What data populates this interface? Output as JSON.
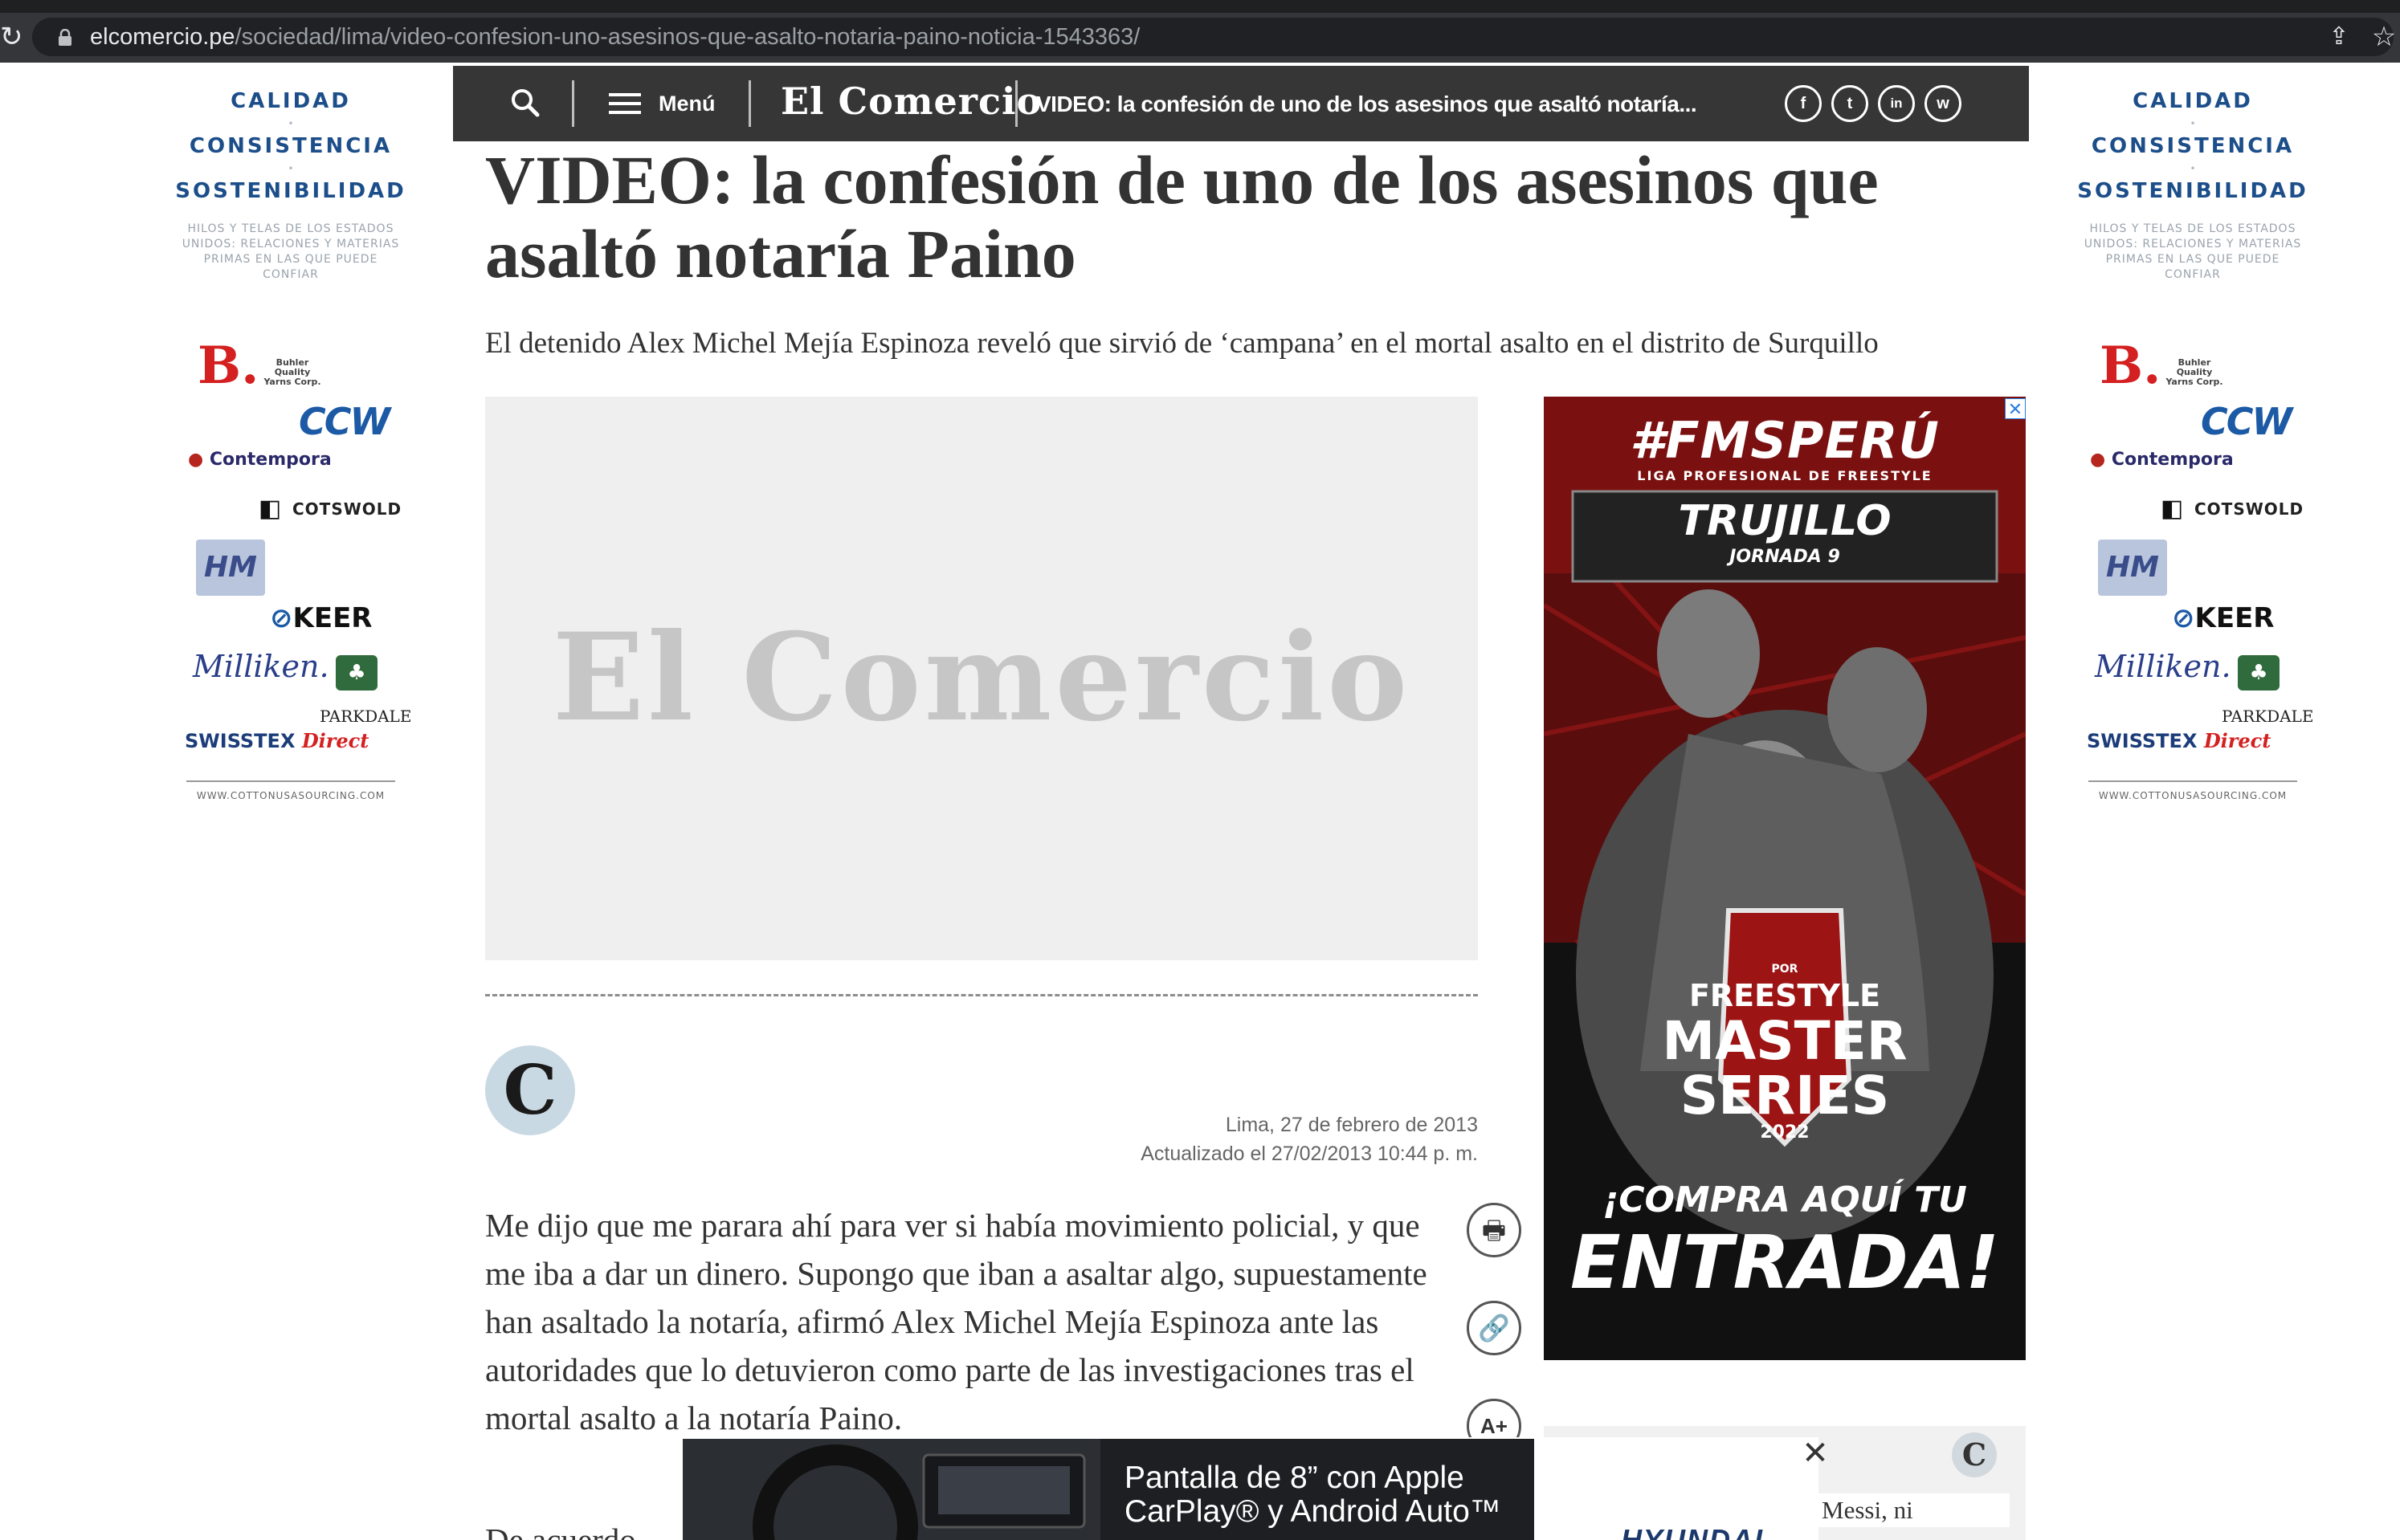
{
  "browser": {
    "url_domain": "elcomercio.pe",
    "url_path": "/sociedad/lima/video-confesion-uno-asesinos-que-asalto-notaria-paino-noticia-1543363/"
  },
  "side_ad": {
    "line1": "CALIDAD",
    "line2": "CONSISTENCIA",
    "line3": "SOSTENIBILIDAD",
    "subtitle": "HILOS Y TELAS DE LOS ESTADOS UNIDOS: RELACIONES Y MATERIAS PRIMAS EN LAS QUE PUEDE CONFIAR",
    "brands": {
      "buhler": "Buhler Quality Yarns Corp.",
      "ccw": "CCW",
      "contempora": "Contempora",
      "cotswold": "COTSWOLD",
      "hamrick": "HM",
      "keer": "KEER",
      "milliken": "Milliken.",
      "parkdale": "PARKDALE",
      "swisstex": "SWISSTEX",
      "swisstex_direct": "Direct"
    },
    "url": "WWW.COTTONUSASOURCING.COM"
  },
  "header": {
    "menu_label": "Menú",
    "logo": "El Comercio",
    "title": "VIDEO: la confesión de uno de los asesinos que asaltó notaría...",
    "social": {
      "facebook": "f",
      "twitter": "t",
      "linkedin": "in",
      "whatsapp": "w"
    }
  },
  "article": {
    "headline": "VIDEO: la confesión de uno de los asesinos que asaltó notaría Paino",
    "deck": "El detenido Alex Michel Mejía Espinoza reveló que sirvió de ‘campana’ en el mortal asalto en el distrito de Surquillo",
    "placeholder_logo": "El Comercio",
    "author_initial": "C",
    "date": "Lima, 27 de febrero de 2013",
    "updated": "Actualizado el 27/02/2013 10:44 p. m.",
    "body_p1": "Me dijo que me parara ahí para ver si había movimiento policial, y que me iba a dar un dinero. Supongo que iban a asaltar algo, supuestamente han asaltado la notaría, afirmó Alex Michel Mejía Espinoza ante las autoridades que lo detuvieron como parte de las investigaciones tras el mortal asalto a la notaría Paino.",
    "body_p2_start": "De acuerdo",
    "tools": {
      "print": "🖶",
      "link": "🔗",
      "font_size": "A+"
    }
  },
  "right_ad": {
    "hashtag": "#FMSPERÚ",
    "league": "LIGA PROFESIONAL DE FREESTYLE",
    "city": "TRUJILLO",
    "round": "JORNADA 9",
    "badge_top": "POR",
    "badge_1": "FREESTYLE",
    "badge_2": "MASTER",
    "badge_3": "SERIES",
    "badge_year": "2022",
    "cta_1": "¡COMPRA AQUÍ TU",
    "cta_2": "ENTRADA!",
    "close": "✕"
  },
  "right_strip": {
    "initial": "C",
    "snippet": "Messi, ni"
  },
  "bottom_ad": {
    "text": "Pantalla de 8” con Apple CarPlay® y Android Auto™",
    "brand": "HYUNDAI",
    "close": "✕"
  }
}
